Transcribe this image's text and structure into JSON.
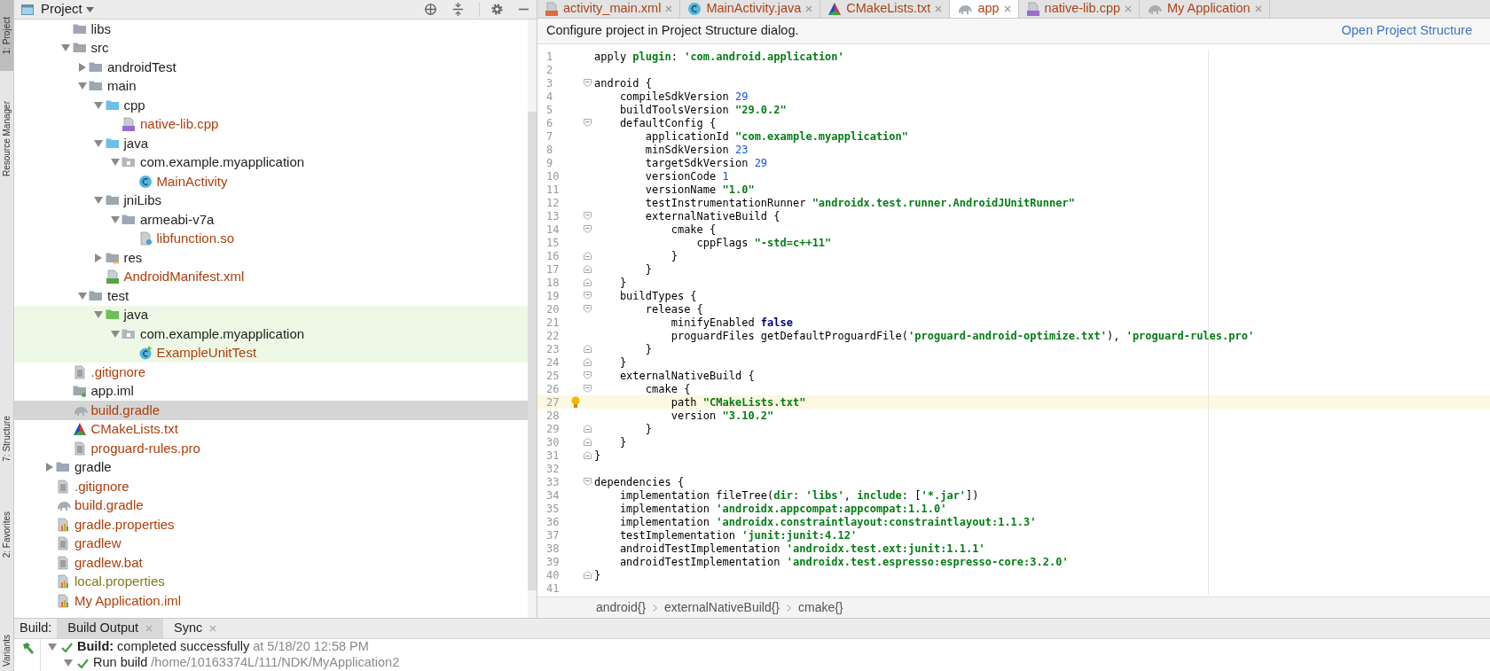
{
  "tool_strip": [
    {
      "label": "1: Project",
      "selected": true
    },
    {
      "label": "Resource Manager",
      "selected": false
    },
    {
      "label": "7: Structure",
      "selected": false
    },
    {
      "label": "2: Favorites",
      "selected": false
    },
    {
      "label": "Variants",
      "selected": false
    }
  ],
  "project_panel": {
    "title": "Project",
    "parent_children": [
      {
        "label": "libs",
        "kind": "folder",
        "color": "#1e1e1e",
        "selected": false,
        "tinted": false
      },
      {
        "label": "src",
        "kind": "folder",
        "color": "#1e1e1e",
        "selected": false,
        "tinted": false,
        "expanded": true,
        "children": [
          {
            "label": "androidTest",
            "kind": "folder",
            "color": "#1e1e1e",
            "selected": false,
            "tinted": false,
            "expanded": false
          },
          {
            "label": "main",
            "kind": "folder",
            "color": "#1e1e1e",
            "selected": false,
            "tinted": false,
            "expanded": true,
            "children": [
              {
                "label": "cpp",
                "kind": "source_folder",
                "color": "#1e1e1e",
                "selected": false,
                "tinted": false,
                "expanded": true,
                "children": [
                  {
                    "label": "native-lib.cpp",
                    "kind": "cpp",
                    "color": "#ad3f0c",
                    "selected": false,
                    "tinted": false
                  }
                ]
              },
              {
                "label": "java",
                "kind": "source_folder",
                "color": "#1e1e1e",
                "selected": false,
                "tinted": false,
                "expanded": true,
                "children": [
                  {
                    "label": "com.example.myapplication",
                    "kind": "package",
                    "color": "#1e1e1e",
                    "selected": false,
                    "tinted": false,
                    "expanded": true,
                    "children": [
                      {
                        "label": "MainActivity",
                        "kind": "class",
                        "color": "#ad3f0c",
                        "selected": false,
                        "tinted": false
                      }
                    ]
                  }
                ]
              },
              {
                "label": "jniLibs",
                "kind": "folder",
                "color": "#1e1e1e",
                "selected": false,
                "tinted": false,
                "expanded": true,
                "children": [
                  {
                    "label": "armeabi-v7a",
                    "kind": "folder",
                    "color": "#1e1e1e",
                    "selected": false,
                    "tinted": false,
                    "expanded": true,
                    "children": [
                      {
                        "label": "libfunction.so",
                        "kind": "so",
                        "color": "#ad3f0c",
                        "selected": false,
                        "tinted": false
                      }
                    ]
                  }
                ]
              },
              {
                "label": "res",
                "kind": "res_folder",
                "color": "#1e1e1e",
                "selected": false,
                "tinted": false,
                "expanded": false
              },
              {
                "label": "AndroidManifest.xml",
                "kind": "manifest",
                "color": "#ad3f0c",
                "selected": false,
                "tinted": false
              }
            ]
          },
          {
            "label": "test",
            "kind": "folder",
            "color": "#1e1e1e",
            "selected": false,
            "tinted": false,
            "expanded": true,
            "children": [
              {
                "label": "java",
                "kind": "test_folder",
                "color": "#1e1e1e",
                "selected": false,
                "tinted": true,
                "expanded": true,
                "children": [
                  {
                    "label": "com.example.myapplication",
                    "kind": "package",
                    "color": "#1e1e1e",
                    "selected": false,
                    "tinted": true,
                    "expanded": true,
                    "children": [
                      {
                        "label": "ExampleUnitTest",
                        "kind": "test_class",
                        "color": "#ad3f0c",
                        "selected": false,
                        "tinted": true
                      }
                    ]
                  }
                ]
              }
            ]
          }
        ]
      },
      {
        "label": ".gitignore",
        "kind": "text",
        "color": "#ad3f0c",
        "selected": false,
        "tinted": false
      },
      {
        "label": "app.iml",
        "kind": "iml",
        "color": "#1e1e1e",
        "selected": false,
        "tinted": false
      },
      {
        "label": "build.gradle",
        "kind": "gradle",
        "color": "#ad3f0c",
        "selected": true,
        "tinted": false
      },
      {
        "label": "CMakeLists.txt",
        "kind": "cmake",
        "color": "#ad3f0c",
        "selected": false,
        "tinted": false
      },
      {
        "label": "proguard-rules.pro",
        "kind": "text",
        "color": "#ad3f0c",
        "selected": false,
        "tinted": false
      }
    ],
    "tree": [
      {
        "label": "gradle",
        "kind": "folder",
        "color": "#1e1e1e",
        "selected": false,
        "tinted": false,
        "expanded": false
      },
      {
        "label": ".gitignore",
        "kind": "text",
        "color": "#ad3f0c",
        "selected": false,
        "tinted": false
      },
      {
        "label": "build.gradle",
        "kind": "gradle",
        "color": "#ad3f0c",
        "selected": false,
        "tinted": false
      },
      {
        "label": "gradle.properties",
        "kind": "properties",
        "color": "#ad3f0c",
        "selected": false,
        "tinted": false
      },
      {
        "label": "gradlew",
        "kind": "text",
        "color": "#ad3f0c",
        "selected": false,
        "tinted": false
      },
      {
        "label": "gradlew.bat",
        "kind": "text",
        "color": "#ad3f0c",
        "selected": false,
        "tinted": false
      },
      {
        "label": "local.properties",
        "kind": "properties",
        "color": "#7b7b1c",
        "selected": false,
        "tinted": false
      },
      {
        "label": "My Application.iml",
        "kind": "properties",
        "color": "#ad3f0c",
        "selected": false,
        "tinted": false
      }
    ]
  },
  "editor": {
    "tabs": [
      {
        "label": "activity_main.xml",
        "kind": "xml",
        "selected": false
      },
      {
        "label": "MainActivity.java",
        "kind": "class",
        "selected": false
      },
      {
        "label": "CMakeLists.txt",
        "kind": "cmake",
        "selected": false
      },
      {
        "label": "app",
        "kind": "gradle",
        "selected": true
      },
      {
        "label": "native-lib.cpp",
        "kind": "cpp",
        "selected": false
      },
      {
        "label": "My Application",
        "kind": "gradle",
        "selected": false
      }
    ],
    "banner": {
      "message": "Configure project in Project Structure dialog.",
      "link": "Open Project Structure"
    },
    "lines": [
      {
        "n": "1",
        "kind": "plain",
        "current": false,
        "tokens": [
          {
            "kind": "plain",
            "text": "apply "
          },
          {
            "kind": "named",
            "text": "plugin"
          },
          {
            "kind": "plain",
            "text": ": "
          },
          {
            "kind": "string",
            "text": "'com.android.application'"
          }
        ]
      },
      {
        "n": "2",
        "kind": "plain",
        "current": false
      },
      {
        "n": "3",
        "kind": "fold_start",
        "current": false,
        "tokens": [
          {
            "kind": "plain",
            "text": "android {"
          }
        ]
      },
      {
        "n": "4",
        "kind": "plain",
        "current": false,
        "tokens": [
          {
            "kind": "plain",
            "text": "    compileSdkVersion "
          },
          {
            "kind": "number",
            "text": "29"
          }
        ]
      },
      {
        "n": "5",
        "kind": "plain",
        "current": false,
        "tokens": [
          {
            "kind": "plain",
            "text": "    buildToolsVersion "
          },
          {
            "kind": "string",
            "text": "\"29.0.2\""
          }
        ]
      },
      {
        "n": "6",
        "kind": "fold_start",
        "current": false,
        "tokens": [
          {
            "kind": "plain",
            "text": "    defaultConfig {"
          }
        ]
      },
      {
        "n": "7",
        "kind": "plain",
        "current": false,
        "tokens": [
          {
            "kind": "plain",
            "text": "        applicationId "
          },
          {
            "kind": "string",
            "text": "\"com.example.myapplication\""
          }
        ]
      },
      {
        "n": "8",
        "kind": "plain",
        "current": false,
        "tokens": [
          {
            "kind": "plain",
            "text": "        minSdkVersion "
          },
          {
            "kind": "number",
            "text": "23"
          }
        ]
      },
      {
        "n": "9",
        "kind": "plain",
        "current": false,
        "tokens": [
          {
            "kind": "plain",
            "text": "        targetSdkVersion "
          },
          {
            "kind": "number",
            "text": "29"
          }
        ]
      },
      {
        "n": "10",
        "kind": "plain",
        "current": false,
        "tokens": [
          {
            "kind": "plain",
            "text": "        versionCode "
          },
          {
            "kind": "number",
            "text": "1"
          }
        ]
      },
      {
        "n": "11",
        "kind": "plain",
        "current": false,
        "tokens": [
          {
            "kind": "plain",
            "text": "        versionName "
          },
          {
            "kind": "string",
            "text": "\"1.0\""
          }
        ]
      },
      {
        "n": "12",
        "kind": "plain",
        "current": false,
        "tokens": [
          {
            "kind": "plain",
            "text": "        testInstrumentationRunner "
          },
          {
            "kind": "string",
            "text": "\"androidx.test.runner.AndroidJUnitRunner\""
          }
        ]
      },
      {
        "n": "13",
        "kind": "fold_start",
        "current": false,
        "tokens": [
          {
            "kind": "plain",
            "text": "        externalNativeBuild {"
          }
        ]
      },
      {
        "n": "14",
        "kind": "fold_start",
        "current": false,
        "tokens": [
          {
            "kind": "plain",
            "text": "            cmake {"
          }
        ]
      },
      {
        "n": "15",
        "kind": "plain",
        "current": false,
        "tokens": [
          {
            "kind": "plain",
            "text": "                cppFlags "
          },
          {
            "kind": "string",
            "text": "\"-std=c++11\""
          }
        ]
      },
      {
        "n": "16",
        "kind": "fold_end",
        "current": false,
        "tokens": [
          {
            "kind": "plain",
            "text": "            }"
          }
        ]
      },
      {
        "n": "17",
        "kind": "fold_end",
        "current": false,
        "tokens": [
          {
            "kind": "plain",
            "text": "        }"
          }
        ]
      },
      {
        "n": "18",
        "kind": "fold_end",
        "current": false,
        "tokens": [
          {
            "kind": "plain",
            "text": "    }"
          }
        ]
      },
      {
        "n": "19",
        "kind": "fold_start",
        "current": false,
        "tokens": [
          {
            "kind": "plain",
            "text": "    buildTypes {"
          }
        ]
      },
      {
        "n": "20",
        "kind": "fold_start",
        "current": false,
        "tokens": [
          {
            "kind": "plain",
            "text": "        release {"
          }
        ]
      },
      {
        "n": "21",
        "kind": "plain",
        "current": false,
        "tokens": [
          {
            "kind": "plain",
            "text": "            minifyEnabled "
          },
          {
            "kind": "keyword",
            "text": "false"
          }
        ]
      },
      {
        "n": "22",
        "kind": "plain",
        "current": false,
        "tokens": [
          {
            "kind": "plain",
            "text": "            proguardFiles getDefaultProguardFile("
          },
          {
            "kind": "string",
            "text": "'proguard-android-optimize.txt'"
          },
          {
            "kind": "plain",
            "text": "), "
          },
          {
            "kind": "string",
            "text": "'proguard-rules.pro'"
          }
        ]
      },
      {
        "n": "23",
        "kind": "fold_end",
        "current": false,
        "tokens": [
          {
            "kind": "plain",
            "text": "        }"
          }
        ]
      },
      {
        "n": "24",
        "kind": "fold_end",
        "current": false,
        "tokens": [
          {
            "kind": "plain",
            "text": "    }"
          }
        ]
      },
      {
        "n": "25",
        "kind": "fold_start",
        "current": false,
        "tokens": [
          {
            "kind": "plain",
            "text": "    externalNativeBuild {"
          }
        ]
      },
      {
        "n": "26",
        "kind": "fold_start",
        "current": false,
        "tokens": [
          {
            "kind": "plain",
            "text": "        cmake {"
          }
        ]
      },
      {
        "n": "27",
        "kind": "plain",
        "current": true,
        "tokens": [
          {
            "kind": "plain",
            "text": "            path "
          },
          {
            "kind": "string",
            "text": "\"CMakeLists.txt\""
          }
        ]
      },
      {
        "n": "28",
        "kind": "plain",
        "current": false,
        "tokens": [
          {
            "kind": "plain",
            "text": "            version "
          },
          {
            "kind": "string",
            "text": "\"3.10.2\""
          }
        ]
      },
      {
        "n": "29",
        "kind": "fold_end",
        "current": false,
        "tokens": [
          {
            "kind": "plain",
            "text": "        }"
          }
        ]
      },
      {
        "n": "30",
        "kind": "fold_end",
        "current": false,
        "tokens": [
          {
            "kind": "plain",
            "text": "    }"
          }
        ]
      },
      {
        "n": "31",
        "kind": "fold_end",
        "current": false,
        "tokens": [
          {
            "kind": "plain",
            "text": "}"
          }
        ]
      },
      {
        "n": "32",
        "kind": "plain",
        "current": false
      },
      {
        "n": "33",
        "kind": "fold_start",
        "current": false,
        "tokens": [
          {
            "kind": "plain",
            "text": "dependencies {"
          }
        ]
      },
      {
        "n": "34",
        "kind": "plain",
        "current": false,
        "tokens": [
          {
            "kind": "plain",
            "text": "    implementation fileTree("
          },
          {
            "kind": "named",
            "text": "dir"
          },
          {
            "kind": "plain",
            "text": ": "
          },
          {
            "kind": "string",
            "text": "'libs'"
          },
          {
            "kind": "plain",
            "text": ", "
          },
          {
            "kind": "named",
            "text": "include"
          },
          {
            "kind": "plain",
            "text": ": ["
          },
          {
            "kind": "string",
            "text": "'*.jar'"
          },
          {
            "kind": "plain",
            "text": "])"
          }
        ]
      },
      {
        "n": "35",
        "kind": "plain",
        "current": false,
        "tokens": [
          {
            "kind": "plain",
            "text": "    implementation "
          },
          {
            "kind": "string",
            "text": "'androidx.appcompat:appcompat:1.1.0'"
          }
        ]
      },
      {
        "n": "36",
        "kind": "plain",
        "current": false,
        "tokens": [
          {
            "kind": "plain",
            "text": "    implementation "
          },
          {
            "kind": "string",
            "text": "'androidx.constraintlayout:constraintlayout:1.1.3'"
          }
        ]
      },
      {
        "n": "37",
        "kind": "plain",
        "current": false,
        "tokens": [
          {
            "kind": "plain",
            "text": "    testImplementation "
          },
          {
            "kind": "string",
            "text": "'junit:junit:4.12'"
          }
        ]
      },
      {
        "n": "38",
        "kind": "plain",
        "current": false,
        "tokens": [
          {
            "kind": "plain",
            "text": "    androidTestImplementation "
          },
          {
            "kind": "string",
            "text": "'androidx.test.ext:junit:1.1.1'"
          }
        ]
      },
      {
        "n": "39",
        "kind": "plain",
        "current": false,
        "tokens": [
          {
            "kind": "plain",
            "text": "    androidTestImplementation "
          },
          {
            "kind": "string",
            "text": "'androidx.test.espresso:espresso-core:3.2.0'"
          }
        ]
      },
      {
        "n": "40",
        "kind": "fold_end",
        "current": false,
        "tokens": [
          {
            "kind": "plain",
            "text": "}"
          }
        ]
      },
      {
        "n": "41",
        "kind": "plain",
        "current": false
      }
    ],
    "breadcrumbs": [
      "android{}",
      "externalNativeBuild{}",
      "cmake{}"
    ]
  },
  "build_panel": {
    "label": "Build:",
    "tabs": [
      {
        "label": "Build Output",
        "selected": true
      },
      {
        "label": "Sync",
        "selected": false
      }
    ],
    "rows": [
      {
        "text": "**Build:** completed successfully",
        "detail": "at 5/18/20 12:58 PM",
        "expanded": true,
        "children": [
          {
            "text": "Run build",
            "detail": "/home/10163374L/111/NDK/MyApplication2",
            "expanded": true
          }
        ]
      }
    ]
  }
}
